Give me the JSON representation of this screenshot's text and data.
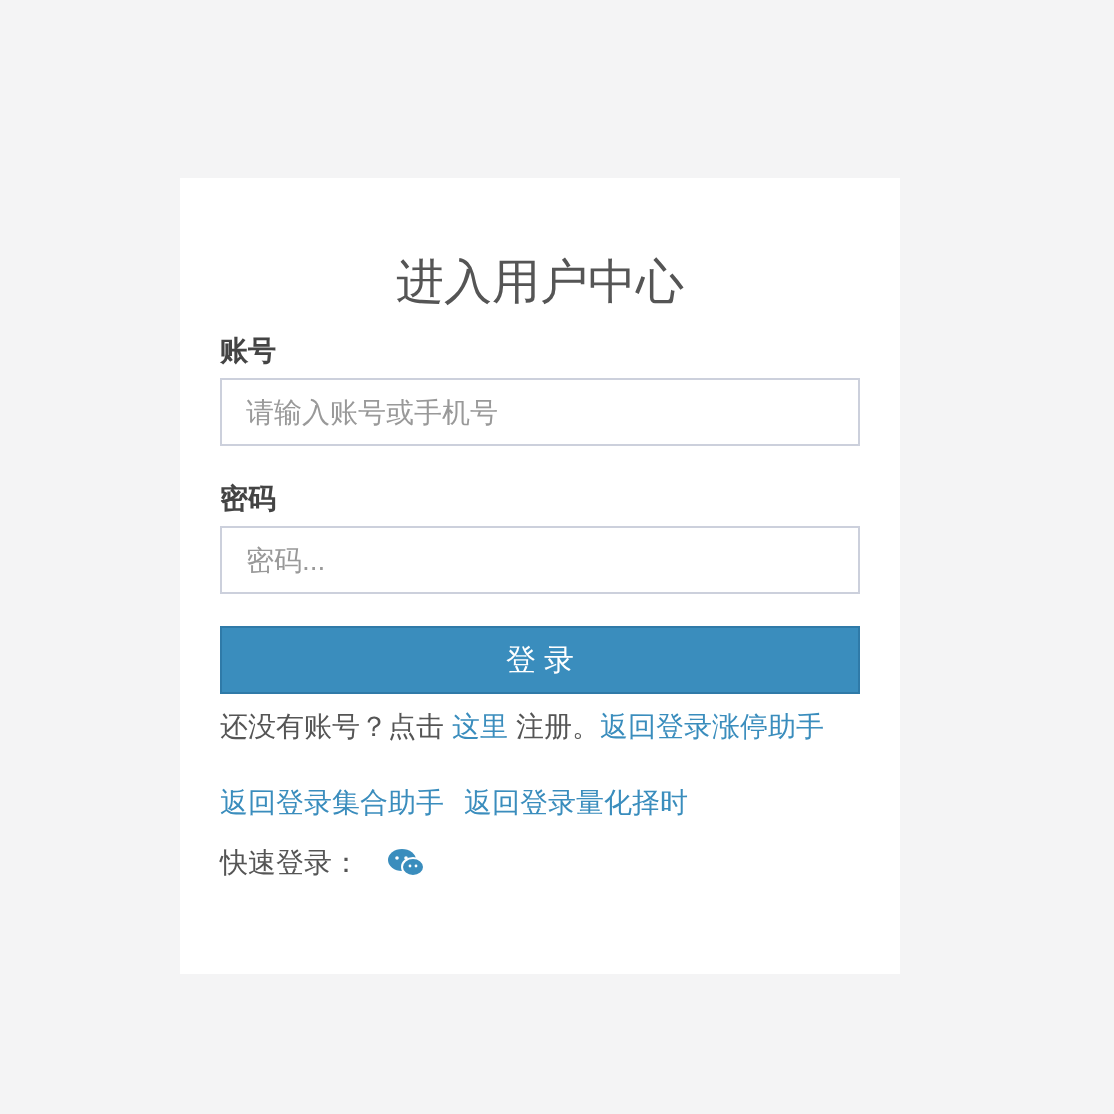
{
  "title": "进入用户中心",
  "fields": [
    {
      "label": "账号",
      "placeholder": "请输入账号或手机号"
    },
    {
      "label": "密码",
      "placeholder": "密码..."
    }
  ],
  "submit": "登 录",
  "register_line": {
    "before": "还没有账号？点击 ",
    "link": "这里",
    "after": " 注册。",
    "link2": "返回登录涨停助手"
  },
  "links": [
    "返回登录集合助手",
    "返回登录量化择时"
  ],
  "quick_login": {
    "label": "快速登录："
  }
}
